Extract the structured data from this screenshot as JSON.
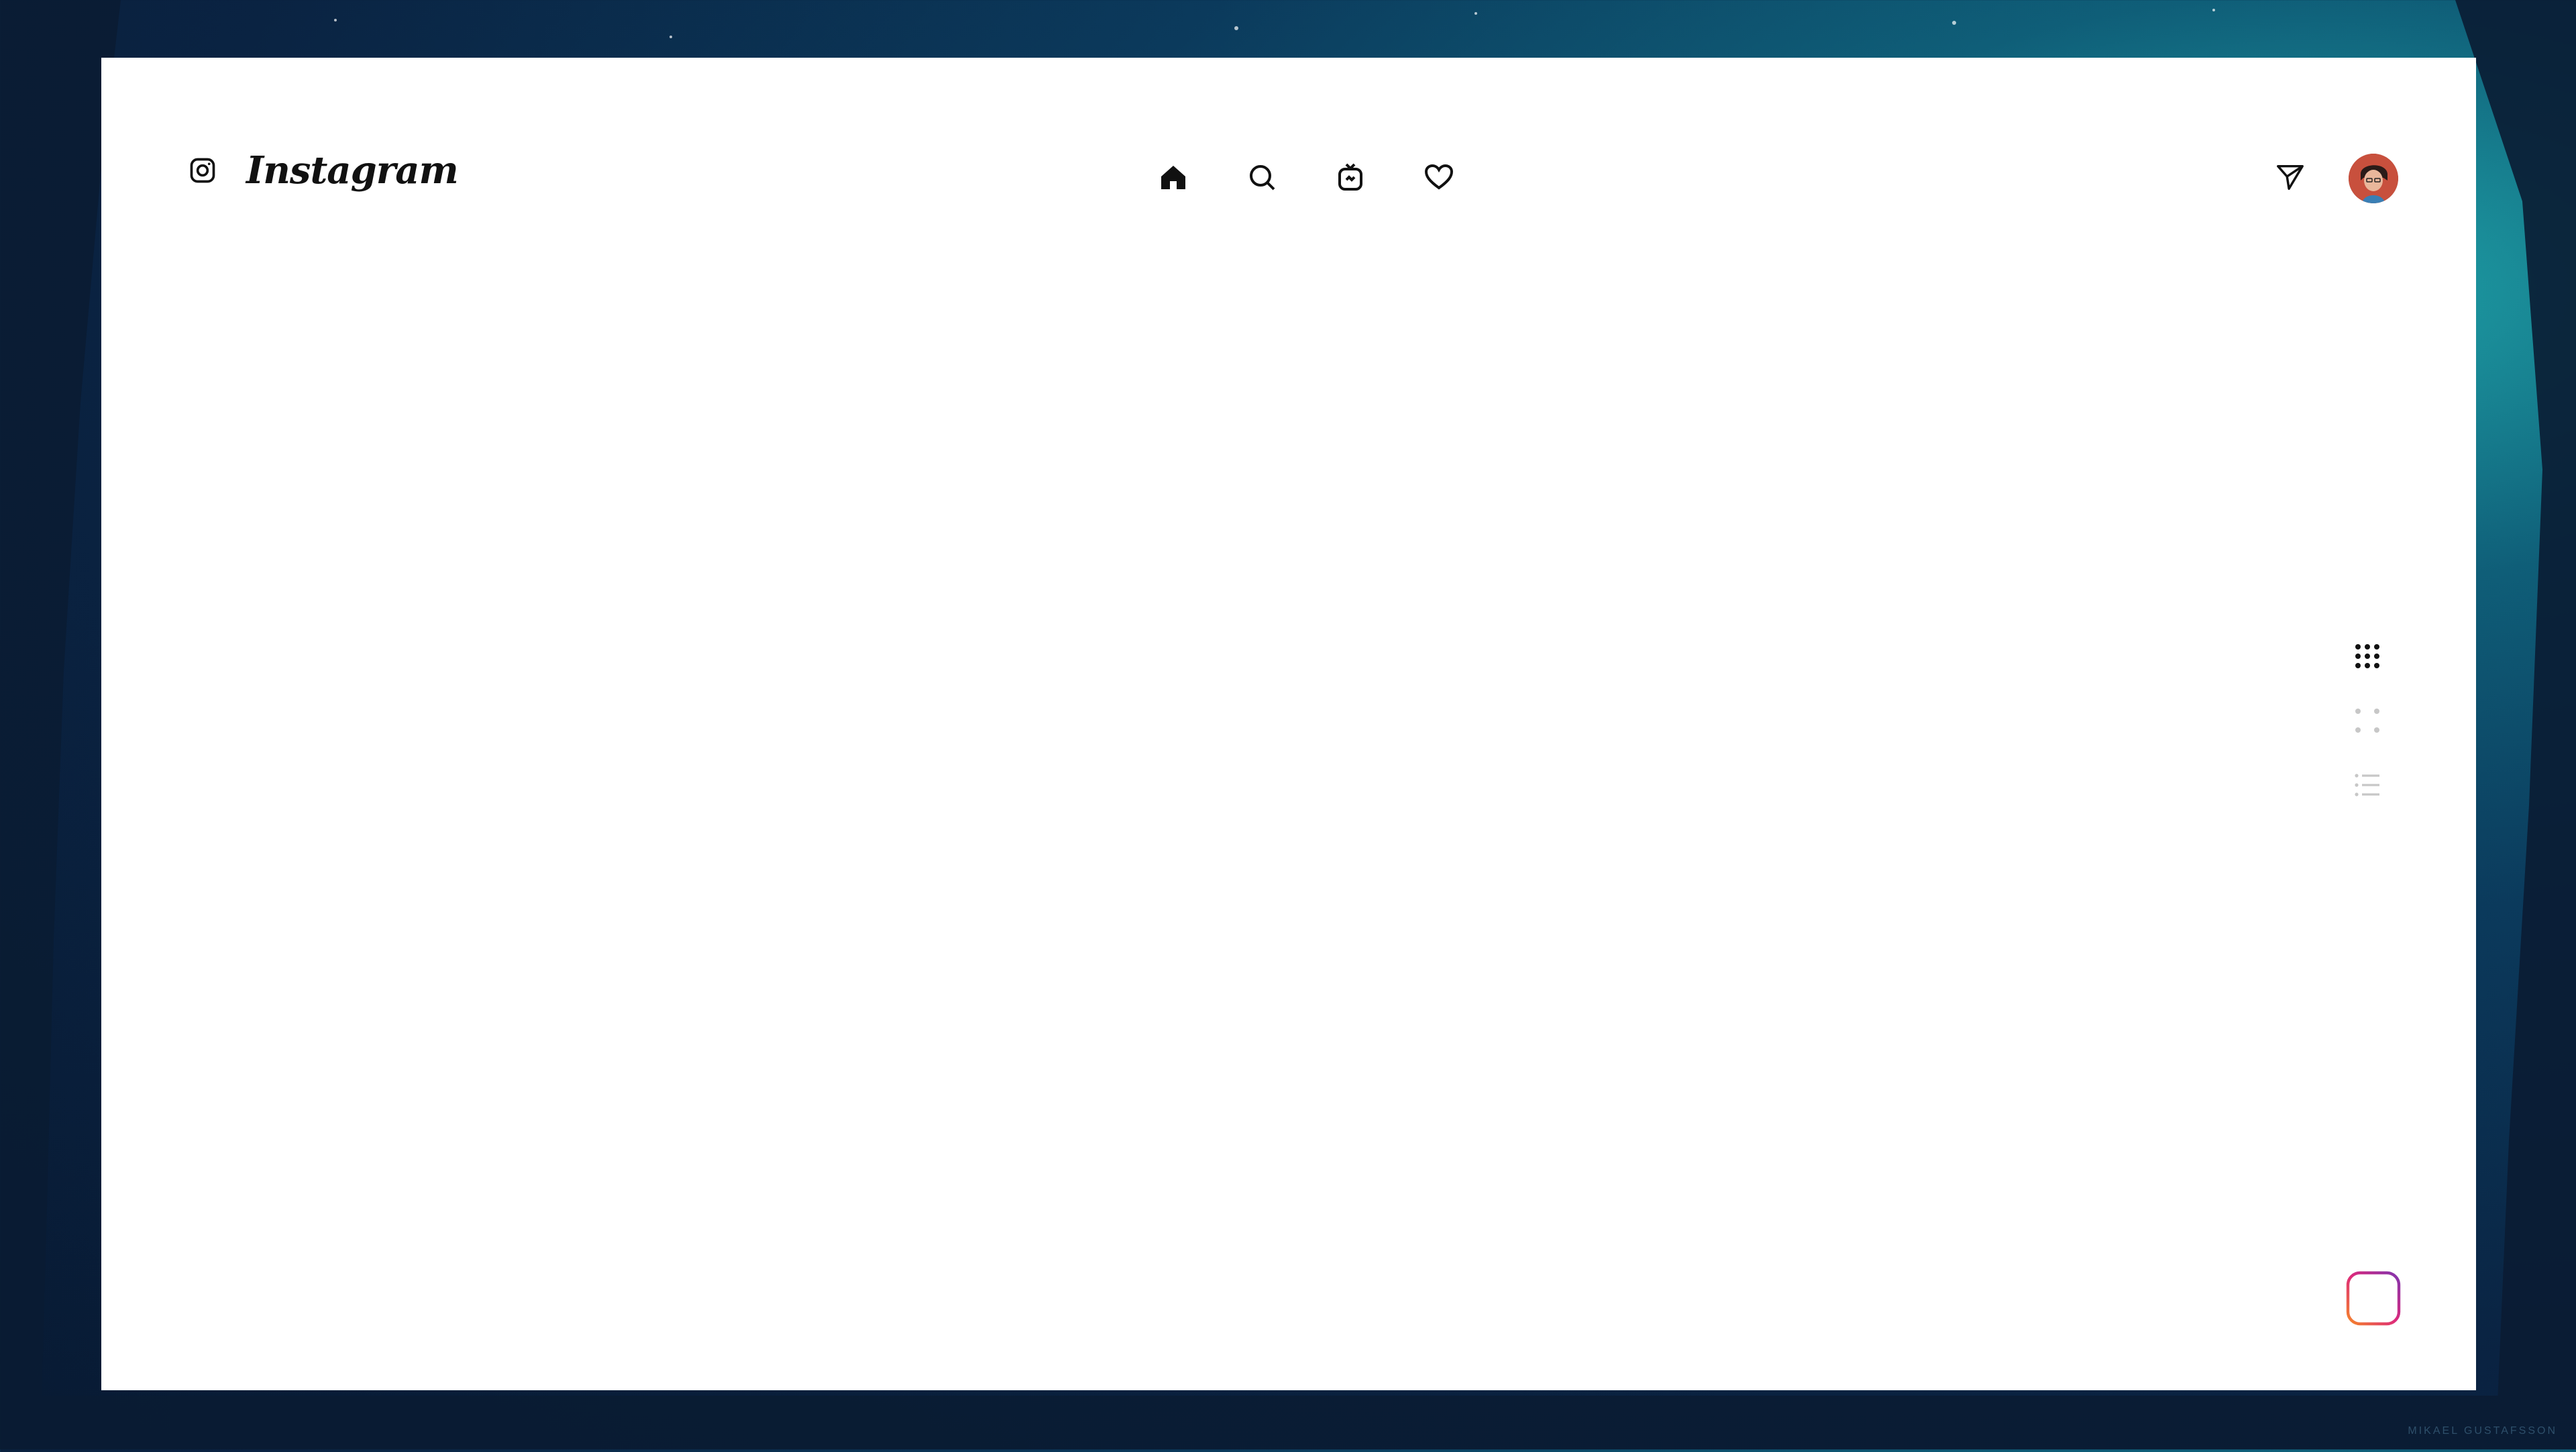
{
  "app": {
    "name": "Instagram",
    "brand_icon": "instagram-glyph-icon"
  },
  "nav": {
    "center": [
      {
        "id": "home",
        "icon": "home-icon",
        "active": true
      },
      {
        "id": "search",
        "icon": "search-icon",
        "active": false
      },
      {
        "id": "igtv",
        "icon": "igtv-icon",
        "active": false
      },
      {
        "id": "activity",
        "icon": "heart-icon",
        "active": false
      }
    ],
    "right": [
      {
        "id": "direct",
        "icon": "paper-plane-icon"
      },
      {
        "id": "profile",
        "icon": "avatar"
      }
    ]
  },
  "view_switcher": [
    {
      "id": "grid-large",
      "icon": "grid-nine-dots-icon",
      "active": true
    },
    {
      "id": "grid-small",
      "icon": "grid-four-dots-icon",
      "active": false
    },
    {
      "id": "list",
      "icon": "list-icon",
      "active": false
    }
  ],
  "actions": {
    "new_post_icon": "plus-square-icon"
  },
  "colors": {
    "active": "#111111",
    "inactive": "#c7c7c7",
    "gradient_start": "#f58529",
    "gradient_mid": "#dd2a7b",
    "gradient_end": "#8134af"
  },
  "wallpaper": {
    "credit": "MIKAEL GUSTAFSSON"
  }
}
